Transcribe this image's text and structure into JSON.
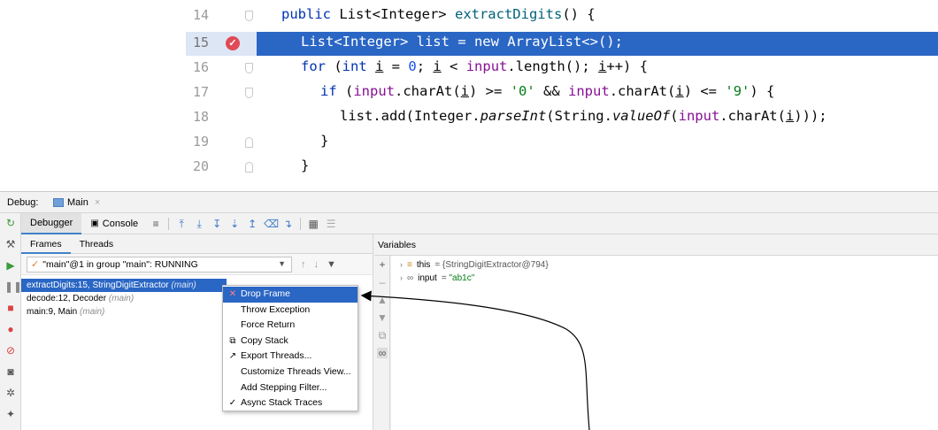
{
  "editor": {
    "lines": [
      {
        "num": "14"
      },
      {
        "num": "15"
      },
      {
        "num": "16"
      },
      {
        "num": "17"
      },
      {
        "num": "18"
      },
      {
        "num": "19"
      },
      {
        "num": "20"
      }
    ],
    "code": {
      "l14a": "public ",
      "l14b": "List<Integer> ",
      "l14c": "extractDigits",
      "l14d": "() {",
      "l15": "List<Integer> list = new ArrayList<>();",
      "l16a": "for ",
      "l16b": "(",
      "l16c": "int ",
      "l16d": "i",
      "l16e": " = ",
      "l16f": "0",
      "l16g": "; ",
      "l16h": "i",
      "l16i": " < ",
      "l16j": "input",
      "l16k": ".length(); ",
      "l16l": "i",
      "l16m": "++) {",
      "l17a": "if ",
      "l17b": "(",
      "l17c": "input",
      "l17d": ".charAt(",
      "l17e": "i",
      "l17f": ") >= ",
      "l17g": "'0'",
      "l17h": " && ",
      "l17i": "input",
      "l17j": ".charAt(",
      "l17k": "i",
      "l17l": ") <= ",
      "l17m": "'9'",
      "l17n": ") {",
      "l18a": "list.add(Integer.",
      "l18b": "parseInt",
      "l18c": "(String.",
      "l18d": "valueOf",
      "l18e": "(",
      "l18f": "input",
      "l18g": ".charAt(",
      "l18h": "i",
      "l18i": ")));",
      "l19": "}",
      "l20": "}"
    }
  },
  "debug": {
    "label": "Debug:",
    "tab": "Main",
    "toolbar": {
      "debugger": "Debugger",
      "console": "Console"
    },
    "frames_tabs": [
      "Frames",
      "Threads"
    ],
    "thread": "\"main\"@1 in group \"main\": RUNNING",
    "frames": [
      {
        "name": "extractDigits:15, StringDigitExtractor",
        "group": "(main)"
      },
      {
        "name": "decode:12, Decoder",
        "group": "(main)"
      },
      {
        "name": "main:9, Main",
        "group": "(main)"
      }
    ],
    "variables_label": "Variables",
    "variables": [
      {
        "name": "this",
        "value": "{StringDigitExtractor@794}"
      },
      {
        "name": "input",
        "value": "\"ab1c\""
      }
    ]
  },
  "context_menu": {
    "items": [
      "Drop Frame",
      "Throw Exception",
      "Force Return",
      "Copy Stack",
      "Export Threads...",
      "Customize Threads View...",
      "Add Stepping Filter...",
      "Async Stack Traces"
    ]
  },
  "colors": {
    "selection": "#2a66c4",
    "breakpoint": "#e04a55",
    "keyword": "#0033b3",
    "field": "#871094",
    "string": "#067d17"
  }
}
